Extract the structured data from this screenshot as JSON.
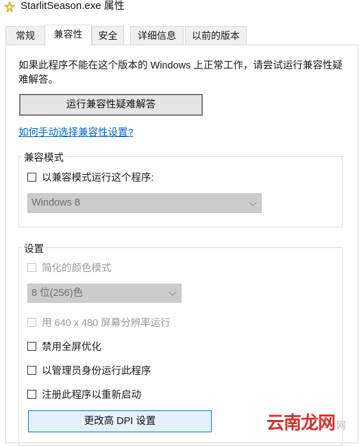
{
  "window": {
    "title": "StarlitSeason.exe 属性"
  },
  "tabs": [
    {
      "label": "常规"
    },
    {
      "label": "兼容性"
    },
    {
      "label": "安全"
    },
    {
      "label": "详细信息"
    },
    {
      "label": "以前的版本"
    }
  ],
  "compat": {
    "description": "如果此程序不能在这个版本的 Windows 上正常工作，请尝试运行兼容性疑难解答。",
    "troubleshoot_button": "运行兼容性疑难解答",
    "manual_link": "如何手动选择兼容性设置?"
  },
  "compat_mode": {
    "group_label": "兼容模式",
    "run_in_compat_label": "以兼容模式运行这个程序:",
    "os_select_value": "Windows 8"
  },
  "settings": {
    "group_label": "设置",
    "reduced_color_label": "简化的颜色模式",
    "color_select_value": "8 位(256)色",
    "res_640_label": "用 640 x 480 屏幕分辨率运行",
    "disable_fullscreen_label": "禁用全屏优化",
    "run_as_admin_label": "以管理员身份运行此程序",
    "register_restart_label": "注册此程序以重新启动",
    "dpi_button": "更改高 DPI 设置"
  },
  "watermark": {
    "text": "云南龙网",
    "suffix": "网"
  },
  "colors": {
    "accent_link": "#0066cc",
    "button_bg": "#e5e5e5",
    "dpi_button_bg": "#e5f1fb",
    "disabled_select_bg": "#cccccc"
  }
}
